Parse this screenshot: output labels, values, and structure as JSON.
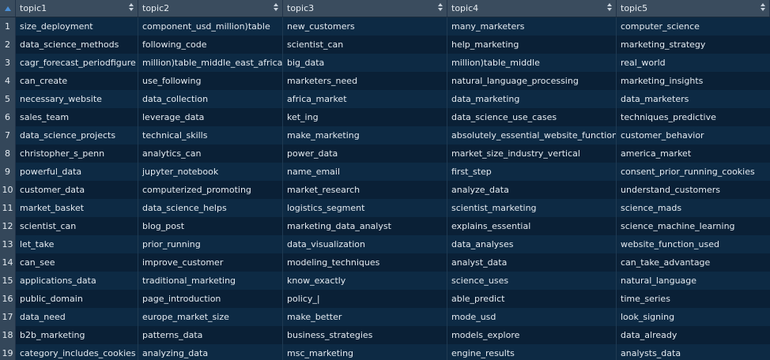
{
  "columns": [
    {
      "label": "topic1"
    },
    {
      "label": "topic2"
    },
    {
      "label": "topic3"
    },
    {
      "label": "topic4"
    },
    {
      "label": "topic5"
    }
  ],
  "rows": [
    {
      "idx": "1",
      "cells": [
        "size_deployment",
        "component_usd_million)table",
        "new_customers",
        "many_marketers",
        "computer_science"
      ]
    },
    {
      "idx": "2",
      "cells": [
        "data_science_methods",
        "following_code",
        "scientist_can",
        "help_marketing",
        "marketing_strategy"
      ]
    },
    {
      "idx": "3",
      "cells": [
        "cagr_forecast_periodfigure",
        "million)table_middle_east_africa",
        "big_data",
        "million)table_middle",
        "real_world"
      ]
    },
    {
      "idx": "4",
      "cells": [
        "can_create",
        "use_following",
        "marketers_need",
        "natural_language_processing",
        "marketing_insights"
      ]
    },
    {
      "idx": "5",
      "cells": [
        "necessary_website",
        "data_collection",
        "africa_market",
        "data_marketing",
        "data_marketers"
      ]
    },
    {
      "idx": "6",
      "cells": [
        "sales_team",
        "leverage_data",
        "ket_ing",
        "data_science_use_cases",
        "techniques_predictive"
      ]
    },
    {
      "idx": "7",
      "cells": [
        "data_science_projects",
        "technical_skills",
        "make_marketing",
        "absolutely_essential_website_function",
        "customer_behavior"
      ]
    },
    {
      "idx": "8",
      "cells": [
        "christopher_s_penn",
        "analytics_can",
        "power_data",
        "market_size_industry_vertical",
        "america_market"
      ]
    },
    {
      "idx": "9",
      "cells": [
        "powerful_data",
        "jupyter_notebook",
        "name_email",
        "first_step",
        "consent_prior_running_cookies"
      ]
    },
    {
      "idx": "10",
      "cells": [
        "customer_data",
        "computerized_promoting",
        "market_research",
        "analyze_data",
        "understand_customers"
      ]
    },
    {
      "idx": "11",
      "cells": [
        "market_basket",
        "data_science_helps",
        "logistics_segment",
        "scientist_marketing",
        "science_mads"
      ]
    },
    {
      "idx": "12",
      "cells": [
        "scientist_can",
        "blog_post",
        "marketing_data_analyst",
        "explains_essential",
        "science_machine_learning"
      ]
    },
    {
      "idx": "13",
      "cells": [
        "let_take",
        "prior_running",
        "data_visualization",
        "data_analyses",
        "website_function_used"
      ]
    },
    {
      "idx": "14",
      "cells": [
        "can_see",
        "improve_customer",
        "modeling_techniques",
        "analyst_data",
        "can_take_advantage"
      ]
    },
    {
      "idx": "15",
      "cells": [
        "applications_data",
        "traditional_marketing",
        "know_exactly",
        "science_uses",
        "natural_language"
      ]
    },
    {
      "idx": "16",
      "cells": [
        "public_domain",
        "page_introduction",
        "policy_|",
        "able_predict",
        "time_series"
      ]
    },
    {
      "idx": "17",
      "cells": [
        "data_need",
        "europe_market_size",
        "make_better",
        "mode_usd",
        "look_signing"
      ]
    },
    {
      "idx": "18",
      "cells": [
        "b2b_marketing",
        "patterns_data",
        "business_strategies",
        "models_explore",
        "data_already"
      ]
    },
    {
      "idx": "19",
      "cells": [
        "category_includes_cookies",
        "analyzing_data",
        "msc_marketing",
        "engine_results",
        "analysts_data"
      ]
    }
  ]
}
